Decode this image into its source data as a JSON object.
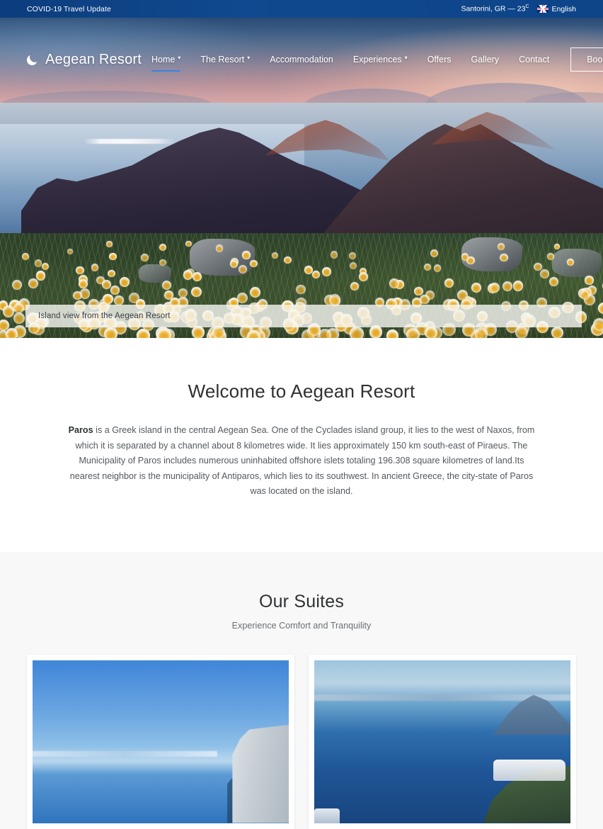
{
  "topbar": {
    "notice": "COVID-19 Travel Update",
    "weather_location": "Santorini, GR — 23",
    "weather_unit": "C",
    "language": "English",
    "flag_icon": "uk-flag-icon"
  },
  "nav": {
    "brand": "Aegean Resort",
    "brand_icon": "crescent-moon-icon",
    "items": [
      {
        "label": "Home",
        "has_dropdown": true,
        "active": true
      },
      {
        "label": "The Resort",
        "has_dropdown": true,
        "active": false
      },
      {
        "label": "Accommodation",
        "has_dropdown": false,
        "active": false
      },
      {
        "label": "Experiences",
        "has_dropdown": true,
        "active": false
      },
      {
        "label": "Offers",
        "has_dropdown": false,
        "active": false
      },
      {
        "label": "Gallery",
        "has_dropdown": false,
        "active": false
      },
      {
        "label": "Contact",
        "has_dropdown": false,
        "active": false
      }
    ],
    "cta_label": "Book Now",
    "active_underline_color": "#3c82e0"
  },
  "hero": {
    "caption": "Island view from the Aegean Resort"
  },
  "welcome": {
    "heading": "Welcome to Aegean Resort",
    "lead": "Paros",
    "body": " is a Greek island in the central Aegean Sea. One of the Cyclades island group, it lies to the west of Naxos, from which it is separated by a channel about 8 kilometres wide. It lies approximately 150 km south-east of Piraeus. The Municipality of Paros includes numerous uninhabited offshore islets totaling 196.308 square kilometres of land.Its nearest neighbor is the municipality of Antiparos, which lies to its southwest. In ancient Greece, the city-state of Paros was located on the island."
  },
  "suites": {
    "heading": "Our Suites",
    "subheading": "Experience Comfort and Tranquility",
    "cards": [
      {
        "image_alt": "Sea view from whitewashed suite terrace"
      },
      {
        "image_alt": "Caldera panorama with cliffside village"
      }
    ]
  }
}
